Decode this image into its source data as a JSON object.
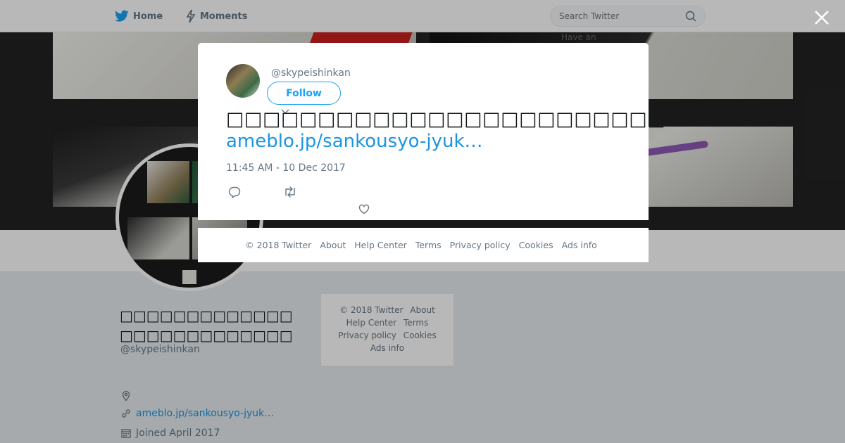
{
  "nav": {
    "home": "Home",
    "moments": "Moments",
    "search_placeholder": "Search Twitter"
  },
  "banner": {
    "photo_text": "Have an"
  },
  "profile": {
    "name": "□□□□□□□□□□□□□□□□□□□□□□□□□□",
    "handle": "@skypeishinkan",
    "location": "",
    "url": "ameblo.jp/sankousyo-jyuk…",
    "joined": "Joined April 2017"
  },
  "footer_card": {
    "copyright": "© 2018 Twitter",
    "about": "About",
    "help": "Help Center",
    "terms": "Terms",
    "privacy": "Privacy policy",
    "cookies": "Cookies",
    "ads": "Ads info"
  },
  "tweet": {
    "handle": "@skypeishinkan",
    "follow_label": "Follow",
    "text": "□□□□□□□□□□□□□□□□□□□□□□□□",
    "link": "ameblo.jp/sankousyo-jyuk…",
    "time": "11:45 AM - 10 Dec 2017"
  },
  "modal_footer": {
    "copyright": "© 2018 Twitter",
    "about": "About",
    "help": "Help Center",
    "terms": "Terms",
    "privacy": "Privacy policy",
    "cookies": "Cookies",
    "ads": "Ads info"
  },
  "colors": {
    "accent": "#1da1f2",
    "link": "#1b95e0",
    "muted": "#657786",
    "text": "#14171a"
  },
  "icons": {
    "home": "bird-icon",
    "moments": "lightning-icon",
    "search": "search-icon",
    "close": "close-icon",
    "reply": "reply-icon",
    "retweet": "retweet-icon",
    "like": "heart-icon"
  }
}
